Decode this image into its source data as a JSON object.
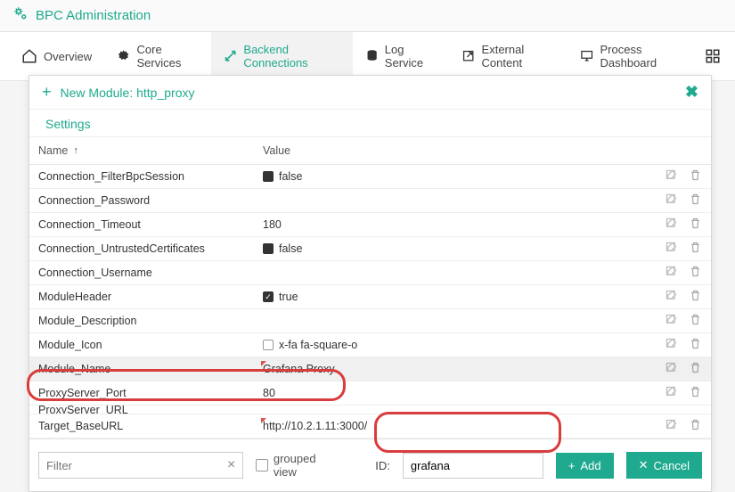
{
  "app": {
    "title": "BPC Administration"
  },
  "tabs": {
    "overview": "Overview",
    "core": "Core Services",
    "backend": "Backend Connections",
    "log": "Log Service",
    "external": "External Content",
    "process": "Process Dashboard"
  },
  "modal": {
    "title": "New Module: http_proxy",
    "subtitle": "Settings",
    "col_name": "Name",
    "col_value": "Value"
  },
  "rows": {
    "r0": {
      "name": "Connection_FilterBpcSession",
      "value": "false"
    },
    "r1": {
      "name": "Connection_Password",
      "value": ""
    },
    "r2": {
      "name": "Connection_Timeout",
      "value": "180"
    },
    "r3": {
      "name": "Connection_UntrustedCertificates",
      "value": "false"
    },
    "r4": {
      "name": "Connection_Username",
      "value": ""
    },
    "r5": {
      "name": "ModuleHeader",
      "value": "true"
    },
    "r6": {
      "name": "Module_Description",
      "value": ""
    },
    "r7": {
      "name": "Module_Icon",
      "value": "x-fa fa-square-o"
    },
    "r8": {
      "name": "Module_Name",
      "value": "Grafana Proxy"
    },
    "r9": {
      "name": "ProxyServer_Port",
      "value": "80"
    },
    "r10": {
      "name": "ProxyServer_URL",
      "value": ""
    },
    "r11": {
      "name": "Target_BaseURL",
      "value": "http://10.2.1.11:3000/"
    }
  },
  "footer": {
    "filter_placeholder": "Filter",
    "grouped": "grouped view",
    "id_label": "ID:",
    "id_value": "grafana",
    "add": "Add",
    "cancel": "Cancel"
  }
}
